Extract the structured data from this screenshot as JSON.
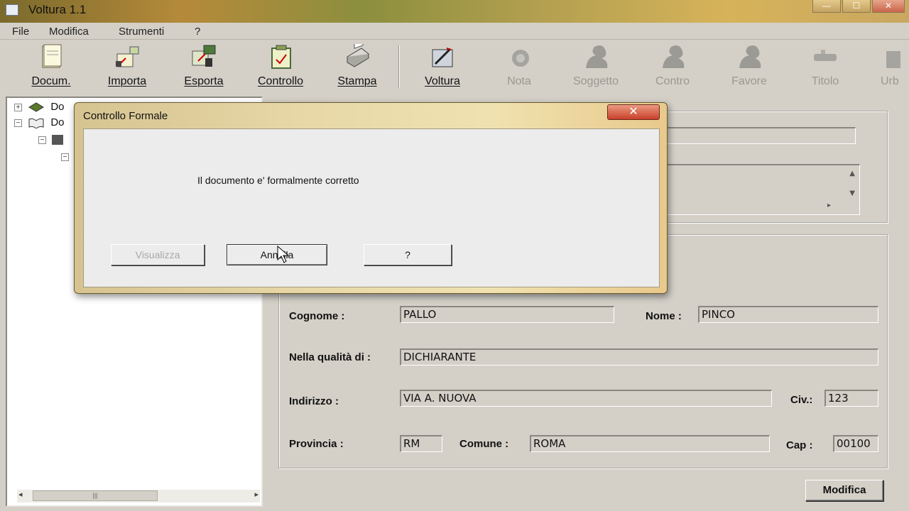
{
  "window": {
    "title": "Voltura 1.1",
    "min": "—",
    "max": "☐",
    "close": "✕"
  },
  "menu": [
    "File",
    "Modifica",
    "Strumenti",
    "?"
  ],
  "toolbar": [
    {
      "label": "Docum.",
      "icon": "document-icon",
      "enabled": true
    },
    {
      "label": "Importa",
      "icon": "import-icon",
      "enabled": true
    },
    {
      "label": "Esporta",
      "icon": "export-icon",
      "enabled": true
    },
    {
      "label": "Controllo",
      "icon": "check-icon",
      "enabled": true
    },
    {
      "label": "Stampa",
      "icon": "printer-icon",
      "enabled": true
    },
    {
      "label": "Voltura",
      "icon": "voltura-icon",
      "enabled": true
    },
    {
      "label": "Nota",
      "icon": "note-icon",
      "enabled": false
    },
    {
      "label": "Soggetto",
      "icon": "person-icon",
      "enabled": false
    },
    {
      "label": "Contro",
      "icon": "person-icon",
      "enabled": false
    },
    {
      "label": "Favore",
      "icon": "person-icon",
      "enabled": false
    },
    {
      "label": "Titolo",
      "icon": "title-icon",
      "enabled": false
    },
    {
      "label": "Urb",
      "icon": "building-icon",
      "enabled": false
    }
  ],
  "tree": {
    "row1": "Do",
    "row2": "Do"
  },
  "form": {
    "cognome_label": "Cognome :",
    "cognome": "PALLO",
    "nome_label": "Nome :",
    "nome": "PINCO",
    "qualita_label": "Nella qualità di :",
    "qualita": "DICHIARANTE",
    "indirizzo_label": "Indirizzo :",
    "indirizzo": "VIA A. NUOVA",
    "civ_label": "Civ.:",
    "civ": "123",
    "provincia_label": "Provincia :",
    "provincia": "RM",
    "comune_label": "Comune :",
    "comune": "ROMA",
    "cap_label": "Cap :",
    "cap": "00100",
    "modifica": "Modifica"
  },
  "dialog": {
    "title": "Controllo Formale",
    "close": "✕",
    "message": "Il documento e' formalmente corretto",
    "btn_visualizza": "Visualizza",
    "btn_annulla": "Annulla",
    "btn_help": "?"
  }
}
